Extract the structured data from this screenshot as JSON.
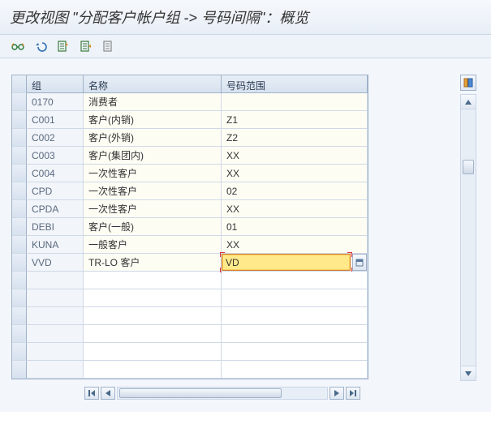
{
  "title": "更改视图 \"分配客户帐户组 -> 号码间隔\"：概览",
  "toolbar": {
    "icons": [
      "glasses-icon",
      "undo-icon",
      "new-entry-icon",
      "copy-entry-icon",
      "delete-entry-icon"
    ]
  },
  "columns": {
    "group": "组",
    "name": "名称",
    "range": "号码范围"
  },
  "rows": [
    {
      "group": "0170",
      "name": "消费者",
      "range": ""
    },
    {
      "group": "C001",
      "name": "客户(内销)",
      "range": "Z1"
    },
    {
      "group": "C002",
      "name": "客户(外销)",
      "range": "Z2"
    },
    {
      "group": "C003",
      "name": "客户(集团内)",
      "range": "XX"
    },
    {
      "group": "C004",
      "name": "一次性客户",
      "range": "XX"
    },
    {
      "group": "CPD",
      "name": "一次性客户",
      "range": "02"
    },
    {
      "group": "CPDA",
      "name": "一次性客户",
      "range": "XX"
    },
    {
      "group": "DEBI",
      "name": "客户(一般)",
      "range": "01"
    },
    {
      "group": "KUNA",
      "name": "一般客户",
      "range": "XX"
    },
    {
      "group": "VVD",
      "name": "TR-LO 客户",
      "range": "VD",
      "active": true
    }
  ],
  "empty_rows": 6,
  "active_value": "VD"
}
